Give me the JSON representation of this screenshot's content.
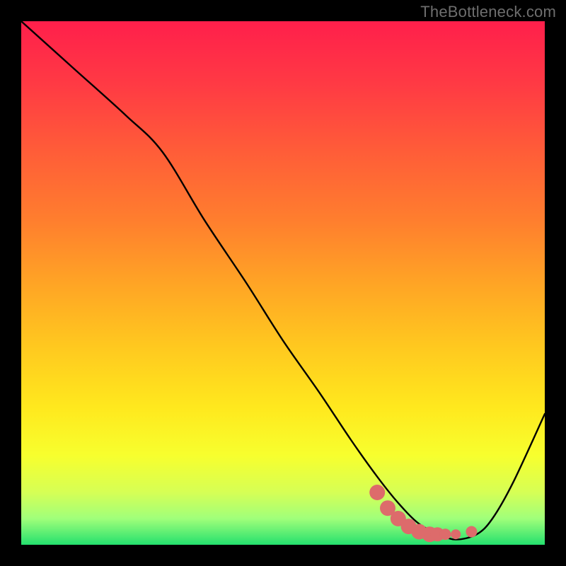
{
  "watermark": "TheBottleneck.com",
  "gradient": {
    "stops": [
      {
        "offset": 0.0,
        "color": "#ff1f4b"
      },
      {
        "offset": 0.12,
        "color": "#ff3a44"
      },
      {
        "offset": 0.25,
        "color": "#ff5d38"
      },
      {
        "offset": 0.38,
        "color": "#ff7e2e"
      },
      {
        "offset": 0.5,
        "color": "#ffa425"
      },
      {
        "offset": 0.62,
        "color": "#ffc81f"
      },
      {
        "offset": 0.74,
        "color": "#ffe91e"
      },
      {
        "offset": 0.83,
        "color": "#f7ff2e"
      },
      {
        "offset": 0.9,
        "color": "#d6ff55"
      },
      {
        "offset": 0.95,
        "color": "#a0ff7a"
      },
      {
        "offset": 1.0,
        "color": "#24e06e"
      }
    ]
  },
  "chart_data": {
    "type": "line",
    "title": "",
    "xlabel": "",
    "ylabel": "",
    "xlim": [
      0,
      100
    ],
    "ylim": [
      0,
      100
    ],
    "series": [
      {
        "name": "curve",
        "x": [
          0,
          10,
          20,
          27,
          35,
          43,
          50,
          57,
          63,
          68,
          72,
          76,
          80,
          83,
          87,
          90,
          94,
          100
        ],
        "values": [
          100,
          91,
          82,
          75,
          62,
          50,
          39,
          29,
          20,
          13,
          8,
          4,
          2,
          1,
          2,
          5,
          12,
          25
        ]
      }
    ],
    "markers": {
      "name": "highlight-dots",
      "color": "#dd6b6b",
      "x": [
        68,
        70,
        72,
        74,
        76,
        78,
        79.5,
        81,
        83,
        86
      ],
      "values": [
        10,
        7,
        5,
        3.5,
        2.5,
        2,
        2,
        2,
        2,
        2.5
      ],
      "radius": [
        11,
        11,
        11,
        11,
        11,
        11,
        10,
        8,
        7,
        8
      ]
    }
  }
}
